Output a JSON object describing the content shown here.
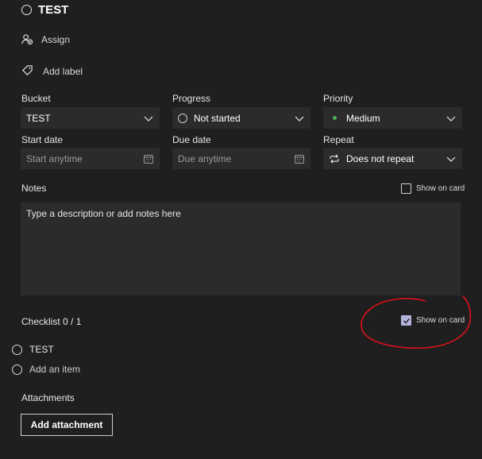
{
  "task": {
    "title": "TEST"
  },
  "assign": {
    "label": "Assign"
  },
  "label_action": {
    "label": "Add label"
  },
  "bucket": {
    "label": "Bucket",
    "value": "TEST"
  },
  "progress": {
    "label": "Progress",
    "value": "Not started"
  },
  "priority": {
    "label": "Priority",
    "value": "Medium",
    "dot_color": "#4caf50"
  },
  "start_date": {
    "label": "Start date",
    "placeholder": "Start anytime"
  },
  "due_date": {
    "label": "Due date",
    "placeholder": "Due anytime"
  },
  "repeat": {
    "label": "Repeat",
    "value": "Does not repeat"
  },
  "notes": {
    "label": "Notes",
    "show_on_card": "Show on card",
    "placeholder": "Type a description or add notes here",
    "show_on_card_checked": false
  },
  "checklist": {
    "label": "Checklist 0 / 1",
    "show_on_card": "Show on card",
    "show_on_card_checked": true,
    "items": [
      {
        "text": "TEST"
      }
    ],
    "add_item": "Add an item"
  },
  "attachments": {
    "label": "Attachments",
    "button": "Add attachment"
  },
  "annotation": {
    "color": "#e0101a"
  }
}
